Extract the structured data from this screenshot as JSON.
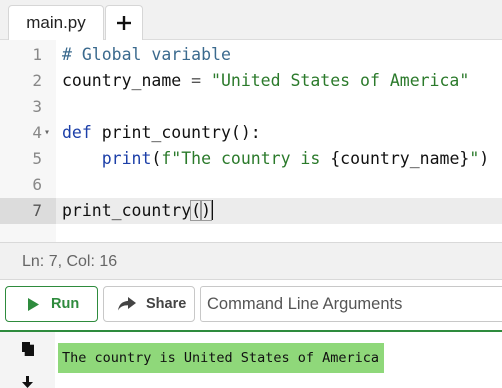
{
  "tabs": [
    {
      "label": "main.py",
      "active": true
    }
  ],
  "editor": {
    "lines": [
      {
        "num": "1",
        "tokens": [
          {
            "t": "# Global variable",
            "c": "comment"
          }
        ]
      },
      {
        "num": "2",
        "tokens": [
          {
            "t": "country_name ",
            "c": "name"
          },
          {
            "t": "=",
            "c": "op"
          },
          {
            "t": " ",
            "c": "name"
          },
          {
            "t": "\"United States of America\"",
            "c": "string"
          }
        ]
      },
      {
        "num": "3",
        "tokens": []
      },
      {
        "num": "4",
        "fold": true,
        "tokens": [
          {
            "t": "def ",
            "c": "kw"
          },
          {
            "t": "print_country():",
            "c": "name"
          }
        ]
      },
      {
        "num": "5",
        "tokens": [
          {
            "t": "    ",
            "c": "name"
          },
          {
            "t": "print",
            "c": "fn"
          },
          {
            "t": "(",
            "c": "name"
          },
          {
            "t": "f\"The country is ",
            "c": "string"
          },
          {
            "t": "{country_name}",
            "c": "name"
          },
          {
            "t": "\"",
            "c": "string"
          },
          {
            "t": ")",
            "c": "name"
          }
        ]
      },
      {
        "num": "6",
        "tokens": []
      },
      {
        "num": "7",
        "active": true,
        "tokens": [
          {
            "t": "print_country",
            "c": "name"
          },
          {
            "t": "(",
            "c": "name",
            "match": true
          },
          {
            "t": ")",
            "c": "name",
            "match": true
          }
        ]
      }
    ]
  },
  "status": {
    "text": "Ln: 7,  Col: 16"
  },
  "toolbar": {
    "run_label": "Run",
    "share_label": "Share",
    "args_placeholder": "Command Line Arguments"
  },
  "output": {
    "text": "The country is United States of America"
  },
  "colors": {
    "accent": "#2e8b3d",
    "output_highlight": "#8fd87a"
  }
}
